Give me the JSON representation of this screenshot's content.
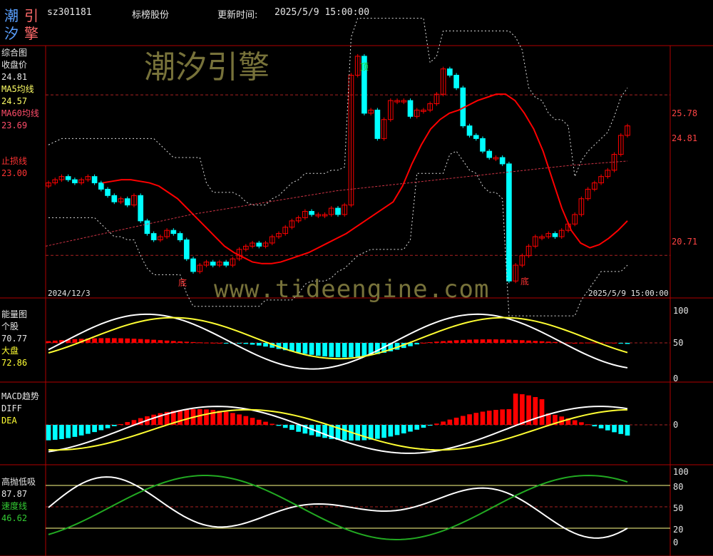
{
  "header": {
    "code": "sz301181",
    "name": "标榜股份",
    "update_label": "更新时间:",
    "update_time": "2025/5/9 15:00:00",
    "logo_chars": [
      "潮",
      "引",
      "汐",
      "擎"
    ]
  },
  "watermarks": {
    "brand": "潮汐引擎",
    "url": "www.tideengine.com"
  },
  "colors": {
    "bull": "#ff0000",
    "bear": "#00ffff",
    "ma5": "#ffff66",
    "ma60": "#ff4444",
    "white": "#ffffff",
    "yellow": "#ffff33",
    "green": "#22aa22",
    "border": "#b00000"
  },
  "main_panel": {
    "title": "综合图",
    "close_label": "收盘价",
    "close_value": "24.81",
    "ma5_label": "MA5均线",
    "ma5_value": "24.57",
    "ma60_label": "MA60均线",
    "ma60_value": "23.69",
    "stop_label": "止损线",
    "stop_value": "23.00",
    "right_ticks": [
      "25.78",
      "24.81",
      "20.71"
    ],
    "top_marker": "顶",
    "bottom_marker": "底",
    "start_date": "2024/12/3",
    "end_date": "2025/5/9 15:00:00"
  },
  "energy_panel": {
    "title": "能量图",
    "stock_label": "个股",
    "stock_value": "70.77",
    "market_label": "大盘",
    "market_value": "72.86",
    "right_ticks": [
      "100",
      "50",
      "0"
    ]
  },
  "macd_panel": {
    "title": "MACD趋势",
    "diff_label": "DIFF",
    "dea_label": "DEA",
    "right_ticks": [
      "0"
    ]
  },
  "hilo_panel": {
    "title": "高抛低吸",
    "value": "87.87",
    "speed_label": "速度线",
    "speed_value": "46.62",
    "right_ticks": [
      "100",
      "80",
      "50",
      "20",
      "0"
    ]
  },
  "chart_data": {
    "type": "line",
    "description_units": "price (CNY) and indicator values",
    "price_range": [
      19.5,
      27.2
    ],
    "close": [
      23.0,
      23.1,
      23.2,
      23.1,
      23.0,
      23.1,
      23.2,
      23.0,
      22.8,
      22.6,
      22.4,
      22.5,
      22.3,
      22.6,
      21.8,
      21.4,
      21.2,
      21.3,
      21.5,
      21.4,
      21.2,
      20.6,
      20.2,
      20.4,
      20.5,
      20.4,
      20.5,
      20.4,
      20.6,
      20.9,
      21.0,
      21.1,
      21.0,
      21.1,
      21.3,
      21.4,
      21.6,
      21.8,
      21.9,
      22.1,
      22.0,
      22.0,
      22.0,
      22.2,
      22.0,
      22.3,
      26.4,
      27.0,
      25.2,
      25.3,
      24.4,
      25.0,
      25.6,
      25.6,
      25.6,
      25.1,
      25.3,
      25.3,
      25.5,
      25.8,
      26.6,
      26.4,
      26.0,
      24.8,
      24.5,
      24.4,
      24.0,
      23.8,
      23.8,
      23.6,
      19.9,
      20.4,
      20.7,
      21.0,
      21.3,
      21.3,
      21.4,
      21.3,
      21.5,
      21.7,
      22.0,
      22.5,
      22.8,
      23.0,
      23.2,
      23.4,
      23.9,
      24.5,
      24.8
    ],
    "ma_short": [
      23.0,
      23.05,
      23.1,
      23.1,
      23.05,
      23.0,
      22.9,
      22.7,
      22.5,
      22.2,
      21.9,
      21.6,
      21.3,
      21.0,
      20.8,
      20.65,
      20.5,
      20.45,
      20.45,
      20.5,
      20.6,
      20.7,
      20.8,
      20.95,
      21.1,
      21.25,
      21.4,
      21.6,
      21.8,
      22.0,
      22.2,
      22.4,
      22.9,
      23.6,
      24.2,
      24.7,
      25.0,
      25.2,
      25.3,
      25.45,
      25.6,
      25.7,
      25.8,
      25.8,
      25.6,
      25.2,
      24.7,
      24.0,
      23.1,
      22.2,
      21.5,
      21.1,
      20.95,
      21.05,
      21.25,
      21.5,
      21.8
    ],
    "ma60": [
      21.0,
      21.2,
      21.4,
      21.6,
      21.8,
      22.0,
      22.15,
      22.3,
      22.45,
      22.6,
      22.75,
      22.85,
      22.95,
      23.05,
      23.15,
      23.25,
      23.35,
      23.45,
      23.55,
      23.62,
      23.69
    ],
    "energy_stock_final": 70.77,
    "energy_market_final": 72.86,
    "hilo_final": 87.87,
    "speed_final": 46.62
  }
}
